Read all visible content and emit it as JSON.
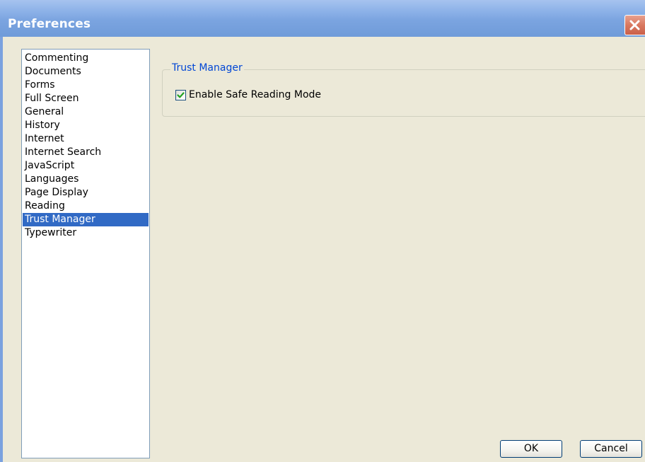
{
  "window": {
    "title": "Preferences"
  },
  "categories": [
    {
      "label": "Commenting"
    },
    {
      "label": "Documents"
    },
    {
      "label": "Forms"
    },
    {
      "label": "Full Screen"
    },
    {
      "label": "General"
    },
    {
      "label": "History"
    },
    {
      "label": "Internet"
    },
    {
      "label": "Internet Search"
    },
    {
      "label": "JavaScript"
    },
    {
      "label": "Languages"
    },
    {
      "label": "Page Display"
    },
    {
      "label": "Reading"
    },
    {
      "label": "Trust Manager"
    },
    {
      "label": "Typewriter"
    }
  ],
  "selected_category": "Trust Manager",
  "panel": {
    "group_title": "Trust Manager",
    "safe_reading": {
      "label": "Enable Safe Reading Mode",
      "checked": true
    }
  },
  "buttons": {
    "ok_label": "OK",
    "cancel_label": "Cancel"
  },
  "colors": {
    "title_gradient_start": "#a6c3ef",
    "title_gradient_end": "#6f9bd9",
    "dialog_background": "#ece9d8",
    "selection": "#316ac5",
    "group_title": "#0046d5",
    "checkmark": "#21a121",
    "close_button": "#d9785f"
  },
  "icons": {
    "close": "close-icon",
    "check": "checkmark-icon"
  }
}
